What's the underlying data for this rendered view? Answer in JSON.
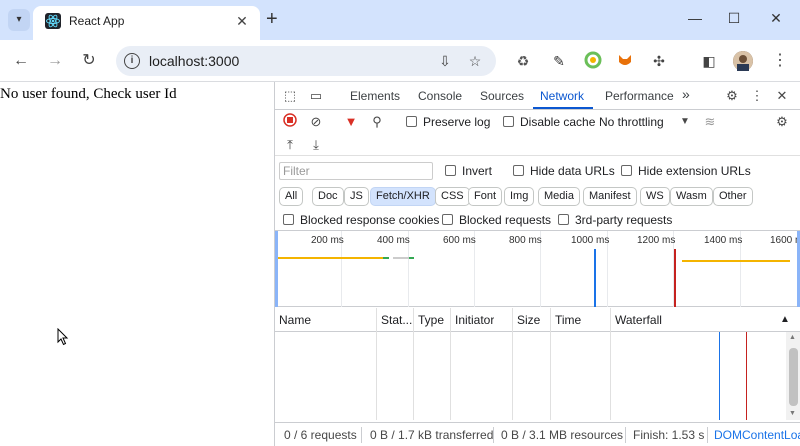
{
  "browser": {
    "tab_title": "React App",
    "url": "localhost:3000",
    "new_tab": "+",
    "close": "✕",
    "back": "←",
    "forward": "→",
    "reload": "↻"
  },
  "page": {
    "message": "No user found, Check user Id"
  },
  "devtools": {
    "tabs": [
      "Elements",
      "Console",
      "Sources",
      "Network",
      "Performance"
    ],
    "active_tab": "Network",
    "more_tabs": "»",
    "network": {
      "preserve_log": "Preserve log",
      "disable_cache": "Disable cache",
      "throttling": "No throttling",
      "filter_placeholder": "Filter",
      "invert": "Invert",
      "hide_data_urls": "Hide data URLs",
      "hide_extension_urls": "Hide extension URLs",
      "chips": [
        "All",
        "Doc",
        "JS",
        "Fetch/XHR",
        "CSS",
        "Font",
        "Img",
        "Media",
        "Manifest",
        "WS",
        "Wasm",
        "Other"
      ],
      "active_chip": "Fetch/XHR",
      "blocked_response_cookies": "Blocked response cookies",
      "blocked_requests": "Blocked requests",
      "third_party_requests": "3rd-party requests",
      "timeline_ticks": [
        "200 ms",
        "400 ms",
        "600 ms",
        "800 ms",
        "1000 ms",
        "1200 ms",
        "1400 ms",
        "1600 ms"
      ],
      "columns": [
        "Name",
        "Stat...",
        "Type",
        "Initiator",
        "Size",
        "Time",
        "Waterfall"
      ],
      "status": {
        "requests": "0 / 6 requests",
        "transferred": "0 B / 1.7 kB transferred",
        "resources": "0 B / 3.1 MB resources",
        "finish": "Finish: 1.53 s",
        "dom_content_loaded": "DOMContentLoa"
      }
    }
  },
  "colors": {
    "accent": "#0b57d0",
    "tabstrip": "#d3e3fd",
    "record": "#d93025",
    "dcl_line": "#1a73e8",
    "load_line": "#c5221f"
  }
}
